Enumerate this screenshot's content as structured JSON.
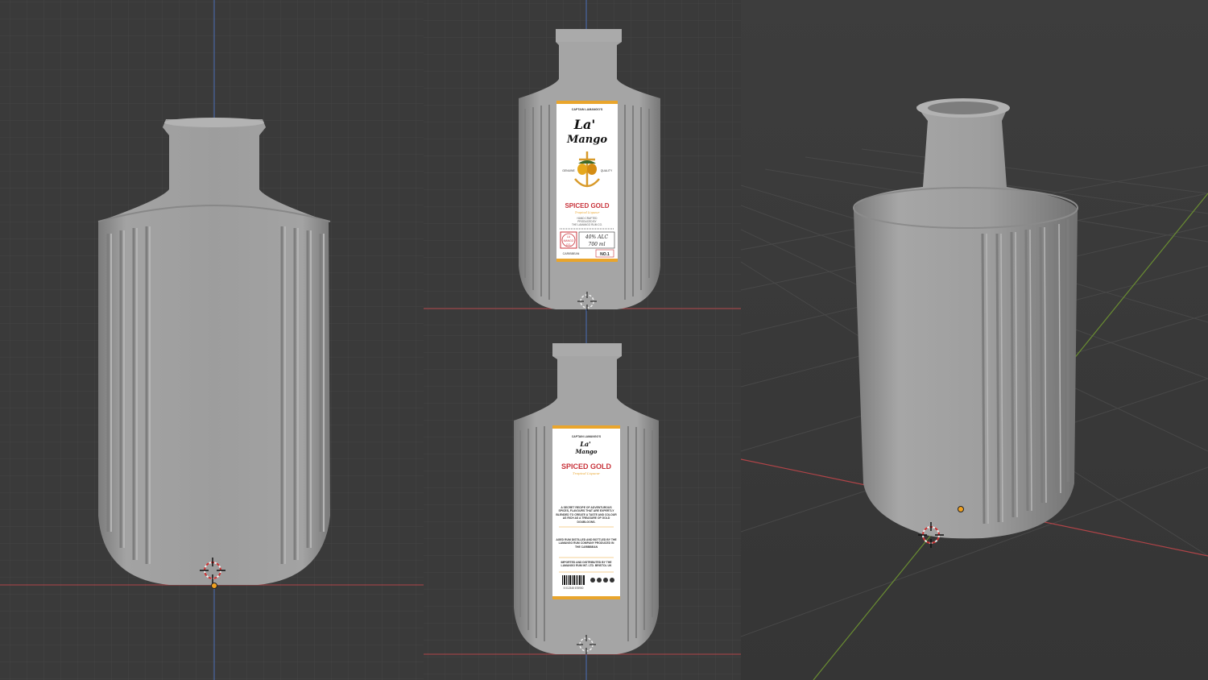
{
  "colors": {
    "grid_bg": "#3a3a3a",
    "grid_line": "#444444",
    "grid_major": "#4c4c4c",
    "axis_x": "#b04448",
    "axis_y": "#6a8d32",
    "axis_z": "#4a6fb5",
    "bottle": "#9b9b9b",
    "label_bg": "#ffffff",
    "label_accent": "#e9a52c",
    "label_red": "#c8323a",
    "origin": "#f0a020"
  },
  "front_label": {
    "maker": "CAPTAIN LAMANGO'S",
    "brand_line1": "La'",
    "brand_line2": "Mango",
    "left_tag": "GENUINE",
    "right_tag": "QUALITY",
    "product": "SPICED GOLD",
    "script": "Tropical Liqueur",
    "info_line1": "HAND CRAFTED",
    "info_line2": "PRODUCED BY",
    "info_line3": "THE LAMANGO RUM CO.",
    "stamp_line1": "LA",
    "stamp_line2": "MANGO",
    "stamp_line3": "CO.",
    "abv": "40% ALC",
    "volume": "700 ml",
    "origin_tag": "CARIBBEAN",
    "number": "NO.1"
  },
  "back_label": {
    "maker": "CAPTAIN LAMANGO'S",
    "brand_line1": "La'",
    "brand_line2": "Mango",
    "product": "SPICED GOLD",
    "script": "Tropical Liqueur",
    "para1": "A SECRET RECIPE OF ADVENTUROUS SPICES, FLAVOURS THAT ARE EXPERTLY BLENDED TO CREATE A TASTE AND COLOUR AS RICH AS A TREASURE OF GOLD DOUBLOONS.",
    "para2": "AGED RUM DISTILLED AND BOTTLED BY THE LAMANGO RUM COMPANY PRODUCED IN THE CARIBBEAN",
    "para3": "IMPORTED AND DISTRIBUTED BY THE LAMANGO RUM INT. LTD. BRISTOL UK",
    "barcode_number": "5 012345 678900"
  }
}
